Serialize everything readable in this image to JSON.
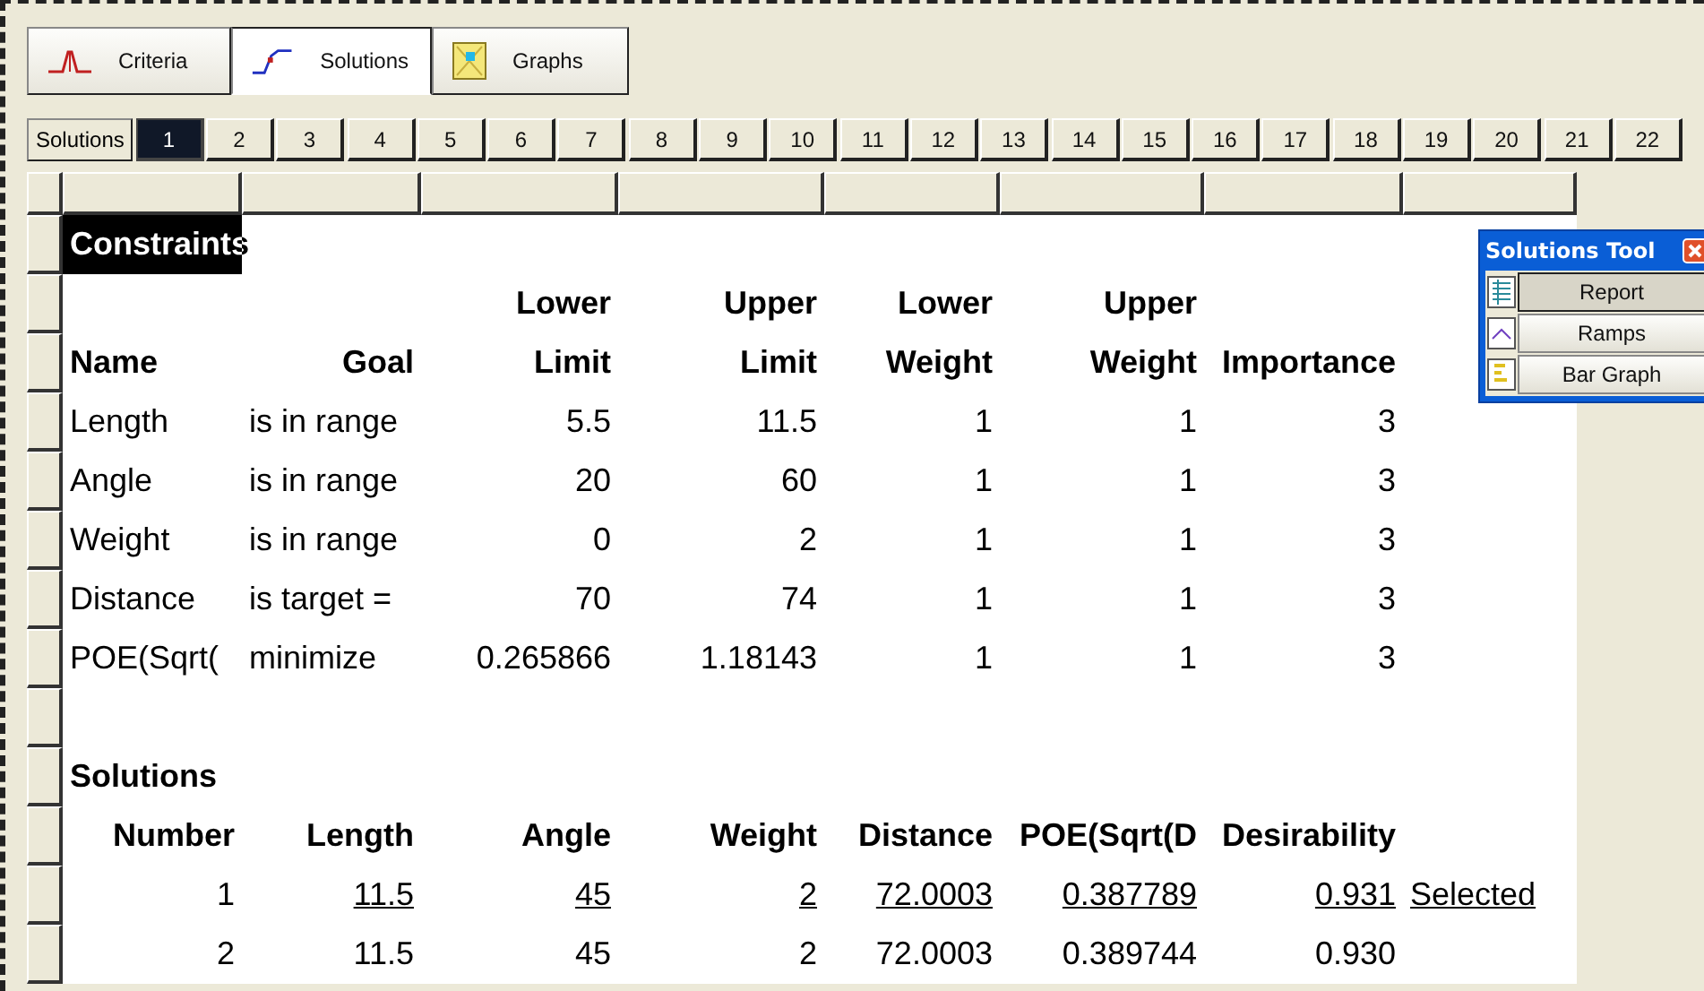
{
  "tabs": [
    {
      "label": "Criteria",
      "kind": "peak",
      "selected": false
    },
    {
      "label": "Solutions",
      "kind": "curve",
      "selected": true
    },
    {
      "label": "Graphs",
      "kind": "chart",
      "selected": false
    }
  ],
  "solution_bar": {
    "label": "Solutions",
    "items": [
      {
        "label": "1",
        "selected": true
      },
      {
        "label": "2",
        "selected": false
      },
      {
        "label": "3",
        "selected": false
      },
      {
        "label": "4",
        "selected": false
      },
      {
        "label": "5",
        "selected": false
      },
      {
        "label": "6",
        "selected": false
      },
      {
        "label": "7",
        "selected": false
      },
      {
        "label": "8",
        "selected": false
      },
      {
        "label": "9",
        "selected": false
      },
      {
        "label": "10",
        "selected": false
      },
      {
        "label": "11",
        "selected": false
      },
      {
        "label": "12",
        "selected": false
      },
      {
        "label": "13",
        "selected": false
      },
      {
        "label": "14",
        "selected": false
      },
      {
        "label": "15",
        "selected": false
      },
      {
        "label": "16",
        "selected": false
      },
      {
        "label": "17",
        "selected": false
      },
      {
        "label": "18",
        "selected": false
      },
      {
        "label": "19",
        "selected": false
      },
      {
        "label": "20",
        "selected": false
      },
      {
        "label": "21",
        "selected": false
      },
      {
        "label": "22",
        "selected": false
      }
    ]
  },
  "constraints": {
    "title": "Constraints",
    "header_rows": [
      [
        "",
        "",
        "Lower",
        "Upper",
        "Lower",
        "Upper",
        ""
      ],
      [
        "Name",
        "Goal",
        "Limit",
        "Limit",
        "Weight",
        "Weight",
        "Importance"
      ]
    ],
    "rows": [
      [
        "Length",
        "is in range",
        "5.5",
        "11.5",
        "1",
        "1",
        "3"
      ],
      [
        "Angle",
        "is in range",
        "20",
        "60",
        "1",
        "1",
        "3"
      ],
      [
        "Weight",
        "is in range",
        "0",
        "2",
        "1",
        "1",
        "3"
      ],
      [
        "Distance",
        "is target =",
        "70",
        "74",
        "1",
        "1",
        "3"
      ],
      [
        "POE(Sqrt(",
        "minimize",
        "0.265866",
        "1.18143",
        "1",
        "1",
        "3"
      ]
    ]
  },
  "solutions": {
    "title": "Solutions",
    "columns": [
      "Number",
      "Length",
      "Angle",
      "Weight",
      "Distance",
      "POE(Sqrt(D",
      "Desirability"
    ],
    "rows": [
      {
        "cells": [
          "1",
          "11.5",
          "45",
          "2",
          "72.0003",
          "0.387789",
          "0.931"
        ],
        "underlined": true,
        "status": "Selected"
      },
      {
        "cells": [
          "2",
          "11.5",
          "45",
          "2",
          "72.0003",
          "0.389744",
          "0.930"
        ],
        "underlined": false
      }
    ]
  },
  "solutions_tool": {
    "title": "Solutions Tool",
    "buttons": [
      {
        "label": "Report",
        "kind": "report",
        "selected": true
      },
      {
        "label": "Ramps",
        "kind": "ramps",
        "selected": false
      },
      {
        "label": "Bar Graph",
        "kind": "bars",
        "selected": false
      }
    ]
  }
}
